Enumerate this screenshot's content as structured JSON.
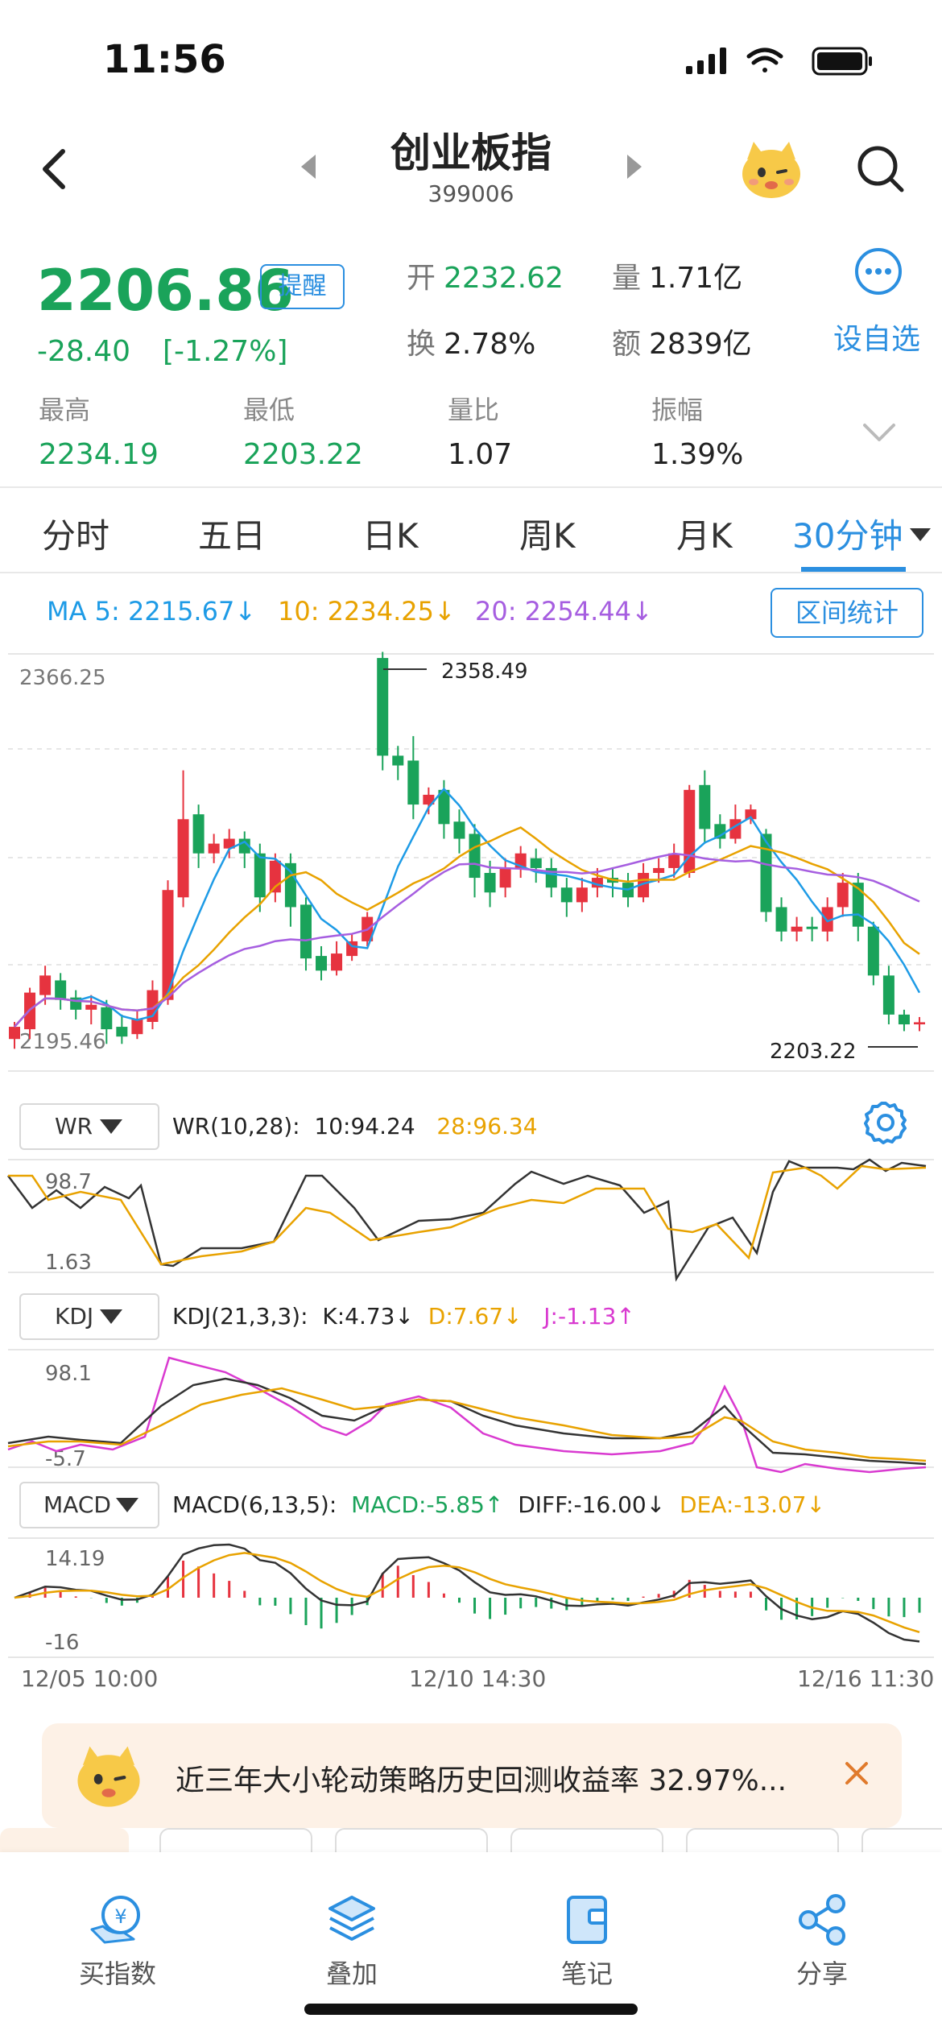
{
  "status": {
    "time": "11:56"
  },
  "nav": {
    "title": "创业板指",
    "code": "399006"
  },
  "quote": {
    "price": "2206.86",
    "alert_label": "提醒",
    "change": "-28.40",
    "change_pct": "[-1.27%]",
    "open_label": "开",
    "open": "2232.62",
    "volume_label": "量",
    "volume": "1.71亿",
    "turnover_label": "换",
    "turnover": "2.78%",
    "amount_label": "额",
    "amount": "2839亿",
    "watch_label": "设自选"
  },
  "stats": [
    {
      "label": "最高",
      "value": "2234.19"
    },
    {
      "label": "最低",
      "value": "2203.22"
    },
    {
      "label": "量比",
      "value": "1.07"
    },
    {
      "label": "振幅",
      "value": "1.39%"
    }
  ],
  "tabs": [
    "分时",
    "五日",
    "日K",
    "周K",
    "月K",
    "30分钟"
  ],
  "active_tab": "30分钟",
  "ma": {
    "ma5": "MA 5: 2215.67↓",
    "ma10": "10: 2234.25↓",
    "ma20": "20: 2254.44↓",
    "range_btn": "区间统计"
  },
  "main_chart": {
    "y_top_label": "2366.25",
    "y_bottom_label": "2195.46",
    "high_label": "2358.49",
    "low_label": "2203.22"
  },
  "wr": {
    "btn": "WR",
    "name": "WR(10,28):",
    "v1": "10:94.24",
    "v2": "28:96.34",
    "top": "98.7",
    "bottom": "1.63"
  },
  "kdj": {
    "btn": "KDJ",
    "name": "KDJ(21,3,3):",
    "k": "K:4.73↓",
    "d": "D:7.67↓",
    "j": "J:-1.13↑",
    "top": "98.1",
    "bottom": "-5.7"
  },
  "macd": {
    "btn": "MACD",
    "name": "MACD(6,13,5):",
    "macd": "MACD:-5.85↑",
    "diff": "DIFF:-16.00↓",
    "dea": "DEA:-13.07↓",
    "top": "14.19",
    "bottom": "-16"
  },
  "time_axis": [
    "12/05 10:00",
    "12/10 14:30",
    "12/16 11:30"
  ],
  "banner": {
    "text": "近三年大小轮动策略历史回测收益率 32.97%..."
  },
  "bottom_nav": [
    {
      "label": "买指数",
      "icon": "buy-index-icon"
    },
    {
      "label": "叠加",
      "icon": "layers-icon"
    },
    {
      "label": "笔记",
      "icon": "note-icon"
    },
    {
      "label": "分享",
      "icon": "share-icon"
    }
  ],
  "colors": {
    "up": "#e6333f",
    "down": "#1aa35a",
    "accent": "#2b8fe0",
    "ma5": "#1e9be6",
    "ma10": "#e8a200",
    "ma20": "#a65ee0"
  },
  "chart_data": {
    "type": "candlestick",
    "interval": "30分钟",
    "y_axis_labels": [
      2366.25,
      2195.46
    ],
    "period_high": 2358.49,
    "period_low": 2203.22,
    "candles": [
      [
        2200,
        2205,
        2196,
        2207
      ],
      [
        2204,
        2219,
        2200,
        2221
      ],
      [
        2218,
        2226,
        2214,
        2230
      ],
      [
        2224,
        2216,
        2212,
        2227
      ],
      [
        2217,
        2212,
        2208,
        2220
      ],
      [
        2212,
        2214,
        2206,
        2218
      ],
      [
        2213,
        2204,
        2198,
        2216
      ],
      [
        2205,
        2201,
        2198,
        2210
      ],
      [
        2202,
        2208,
        2200,
        2212
      ],
      [
        2207,
        2220,
        2204,
        2224
      ],
      [
        2216,
        2261,
        2214,
        2265
      ],
      [
        2258,
        2290,
        2254,
        2310
      ],
      [
        2292,
        2276,
        2270,
        2296
      ],
      [
        2276,
        2280,
        2272,
        2284
      ],
      [
        2278,
        2282,
        2274,
        2286
      ],
      [
        2282,
        2276,
        2270,
        2285
      ],
      [
        2276,
        2258,
        2252,
        2280
      ],
      [
        2260,
        2273,
        2256,
        2276
      ],
      [
        2272,
        2254,
        2246,
        2276
      ],
      [
        2255,
        2233,
        2228,
        2258
      ],
      [
        2234,
        2228,
        2224,
        2238
      ],
      [
        2228,
        2235,
        2226,
        2240
      ],
      [
        2234,
        2240,
        2232,
        2243
      ],
      [
        2240,
        2250,
        2238,
        2252
      ],
      [
        2356,
        2316,
        2310,
        2358.49
      ],
      [
        2316,
        2312,
        2306,
        2320
      ],
      [
        2314,
        2296,
        2290,
        2324
      ],
      [
        2296,
        2300,
        2292,
        2303
      ],
      [
        2302,
        2288,
        2282,
        2306
      ],
      [
        2289,
        2282,
        2276,
        2294
      ],
      [
        2284,
        2266,
        2258,
        2288
      ],
      [
        2268,
        2260,
        2254,
        2273
      ],
      [
        2262,
        2270,
        2258,
        2274
      ],
      [
        2270,
        2276,
        2266,
        2279
      ],
      [
        2274,
        2270,
        2264,
        2278
      ],
      [
        2270,
        2262,
        2258,
        2274
      ],
      [
        2262,
        2256,
        2250,
        2266
      ],
      [
        2256,
        2262,
        2252,
        2266
      ],
      [
        2262,
        2266,
        2258,
        2270
      ],
      [
        2266,
        2264,
        2258,
        2270
      ],
      [
        2264,
        2258,
        2254,
        2268
      ],
      [
        2258,
        2268,
        2256,
        2272
      ],
      [
        2268,
        2270,
        2264,
        2274
      ],
      [
        2270,
        2276,
        2266,
        2280
      ],
      [
        2268,
        2302,
        2266,
        2304
      ],
      [
        2304,
        2286,
        2280,
        2310
      ],
      [
        2288,
        2282,
        2278,
        2292
      ],
      [
        2282,
        2290,
        2280,
        2296
      ],
      [
        2290,
        2294,
        2288,
        2296
      ],
      [
        2284,
        2252,
        2248,
        2286
      ],
      [
        2254,
        2244,
        2240,
        2258
      ],
      [
        2244,
        2246,
        2240,
        2250
      ],
      [
        2246,
        2245,
        2240,
        2250
      ],
      [
        2244,
        2254,
        2240,
        2258
      ],
      [
        2254,
        2264,
        2250,
        2268
      ],
      [
        2264,
        2246,
        2240,
        2268
      ],
      [
        2246,
        2226,
        2222,
        2248
      ],
      [
        2226,
        2210,
        2206,
        2230
      ],
      [
        2210,
        2206,
        2203.22,
        2212
      ],
      [
        2206,
        2206.86,
        2203.22,
        2209
      ]
    ]
  }
}
